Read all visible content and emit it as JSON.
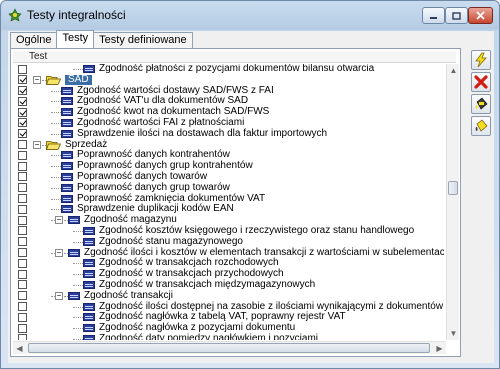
{
  "window": {
    "title": "Testy integralności"
  },
  "tabs": [
    {
      "label": "Ogólne",
      "active": false
    },
    {
      "label": "Testy",
      "active": true
    },
    {
      "label": "Testy definiowane",
      "active": false
    }
  ],
  "grid": {
    "header": "Test",
    "rows": [
      {
        "label": "Zgodność płatności z pozycjami dokumentów bilansu otwarcia",
        "level": 3,
        "type": "leaf",
        "checked": false,
        "selected": false
      },
      {
        "label": "SAD",
        "level": 1,
        "type": "folder",
        "checked": true,
        "selected": true,
        "expanded": true
      },
      {
        "label": "Zgodność wartości dostawy SAD/FWS z FAI",
        "level": 2,
        "type": "leaf",
        "checked": true,
        "selected": false
      },
      {
        "label": "Zgodność VAT'u dla dokumentów SAD",
        "level": 2,
        "type": "leaf",
        "checked": true,
        "selected": false
      },
      {
        "label": "Zgodność kwot na dokumentach SAD/FWS",
        "level": 2,
        "type": "leaf",
        "checked": true,
        "selected": false
      },
      {
        "label": "Zgodność wartości FAI z płatnościami",
        "level": 2,
        "type": "leaf",
        "checked": true,
        "selected": false
      },
      {
        "label": "Sprawdzenie ilości na dostawach dla faktur importowych",
        "level": 2,
        "type": "leaf",
        "checked": true,
        "selected": false
      },
      {
        "label": "Sprzedaż",
        "level": 1,
        "type": "folder",
        "checked": false,
        "selected": false,
        "expanded": true
      },
      {
        "label": "Poprawność danych kontrahentów",
        "level": 2,
        "type": "leaf",
        "checked": false,
        "selected": false
      },
      {
        "label": "Poprawność danych grup kontrahentów",
        "level": 2,
        "type": "leaf",
        "checked": false,
        "selected": false
      },
      {
        "label": "Poprawność danych towarów",
        "level": 2,
        "type": "leaf",
        "checked": false,
        "selected": false
      },
      {
        "label": "Poprawność danych grup towarów",
        "level": 2,
        "type": "leaf",
        "checked": false,
        "selected": false
      },
      {
        "label": "Poprawność zamknięcia dokumentów VAT",
        "level": 2,
        "type": "leaf",
        "checked": false,
        "selected": false
      },
      {
        "label": "Sprawdzenie duplikacji kodów EAN",
        "level": 2,
        "type": "leaf",
        "checked": false,
        "selected": false
      },
      {
        "label": "Zgodność magazynu",
        "level": 2,
        "type": "group",
        "checked": false,
        "selected": false,
        "expanded": true
      },
      {
        "label": "Zgodność kosztów księgowego i rzeczywistego oraz stanu handlowego",
        "level": 3,
        "type": "leaf",
        "checked": false,
        "selected": false
      },
      {
        "label": "Zgodność stanu magazynowego",
        "level": 3,
        "type": "leaf",
        "checked": false,
        "selected": false
      },
      {
        "label": "Zgodność ilości i kosztów w elementach transakcji z wartościami w subelementach",
        "level": 2,
        "type": "group",
        "checked": false,
        "selected": false,
        "expanded": true
      },
      {
        "label": "Zgodność w transakcjach rozchodowych",
        "level": 3,
        "type": "leaf",
        "checked": false,
        "selected": false
      },
      {
        "label": "Zgodność w transakcjach przychodowych",
        "level": 3,
        "type": "leaf",
        "checked": false,
        "selected": false
      },
      {
        "label": "Zgodność w transakcjach międzymagazynowych",
        "level": 3,
        "type": "leaf",
        "checked": false,
        "selected": false
      },
      {
        "label": "Zgodność transakcji",
        "level": 2,
        "type": "group",
        "checked": false,
        "selected": false,
        "expanded": true
      },
      {
        "label": "Zgodność ilości dostępnej na zasobie z ilościami wynikającymi z dokumentów",
        "level": 3,
        "type": "leaf",
        "checked": false,
        "selected": false
      },
      {
        "label": "Zgodność nagłówka z tabelą VAT, poprawny rejestr VAT",
        "level": 3,
        "type": "leaf",
        "checked": false,
        "selected": false
      },
      {
        "label": "Zgodność nagłówka z pozycjami dokumentu",
        "level": 3,
        "type": "leaf",
        "checked": false,
        "selected": false
      },
      {
        "label": "Zgodność daty pomiędzy nagłówkiem i pozycjami",
        "level": 3,
        "type": "leaf",
        "checked": false,
        "selected": false
      }
    ]
  },
  "side_buttons": [
    {
      "name": "run-tests-button",
      "icon": "lightning-icon"
    },
    {
      "name": "cancel-button",
      "icon": "red-x-icon"
    },
    {
      "name": "select-all-button",
      "icon": "paint-bucket-icon"
    },
    {
      "name": "select-none-button",
      "icon": "paint-bucket-yellow-icon"
    }
  ],
  "colors": {
    "selection": "#3a6ea5",
    "folder": "#f2d43a",
    "leaf_icon": "#2a3f9a"
  }
}
